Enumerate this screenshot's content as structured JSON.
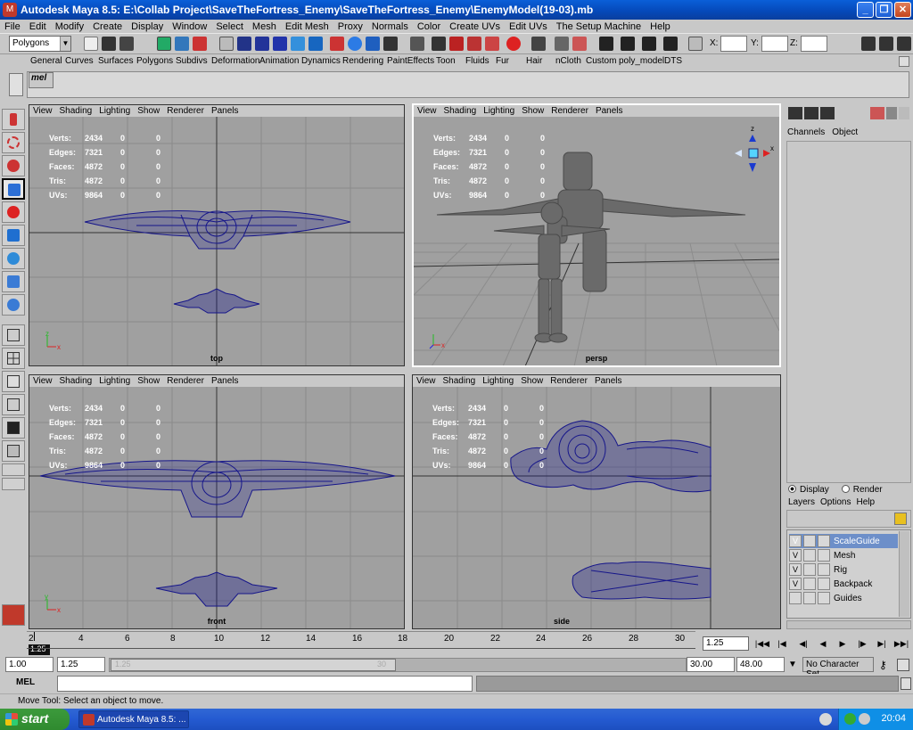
{
  "window": {
    "title": "Autodesk Maya 8.5: E:\\Collab Project\\SaveTheFortress_Enemy\\SaveTheFortress_Enemy\\EnemyModel(19-03).mb",
    "minimize": "_",
    "maximize": "❐",
    "close": "✕"
  },
  "menus": [
    "File",
    "Edit",
    "Modify",
    "Create",
    "Display",
    "Window",
    "Select",
    "Mesh",
    "Edit Mesh",
    "Proxy",
    "Normals",
    "Color",
    "Create UVs",
    "Edit UVs",
    "The Setup Machine",
    "Help"
  ],
  "status_line": {
    "menu_set": "Polygons",
    "x_label": "X:",
    "y_label": "Y:",
    "z_label": "Z:"
  },
  "shelf_tabs": [
    "General",
    "Curves",
    "Surfaces",
    "Polygons",
    "Subdivs",
    "Deformation",
    "Animation",
    "Dynamics",
    "Rendering",
    "PaintEffects",
    "Toon",
    "Fluids",
    "Fur",
    "Hair",
    "nCloth",
    "Custom",
    "poly_model",
    "DTS"
  ],
  "shelf": {
    "mel_button": "mel"
  },
  "viewport_menu": [
    "View",
    "Shading",
    "Lighting",
    "Show",
    "Renderer",
    "Panels"
  ],
  "hud": {
    "rows": [
      {
        "label": "Verts:",
        "v1": "2434",
        "v2": "0",
        "v3": "0"
      },
      {
        "label": "Edges:",
        "v1": "7321",
        "v2": "0",
        "v3": "0"
      },
      {
        "label": "Faces:",
        "v1": "4872",
        "v2": "0",
        "v3": "0"
      },
      {
        "label": "Tris:",
        "v1": "4872",
        "v2": "0",
        "v3": "0"
      },
      {
        "label": "UVs:",
        "v1": "9864",
        "v2": "0",
        "v3": "0"
      }
    ]
  },
  "viewports": {
    "top": "top",
    "persp": "persp",
    "front": "front",
    "side": "side"
  },
  "axes": {
    "x": "x",
    "y": "y",
    "z": "z"
  },
  "channel_box": {
    "tabs": [
      "Channels",
      "Object"
    ]
  },
  "layer_editor": {
    "display_radio": "Display",
    "render_radio": "Render",
    "menu": [
      "Layers",
      "Options",
      "Help"
    ],
    "layers": [
      {
        "vis": "V",
        "name": "ScaleGuide",
        "selected": true
      },
      {
        "vis": "V",
        "name": "Mesh",
        "selected": false
      },
      {
        "vis": "V",
        "name": "Rig",
        "selected": false
      },
      {
        "vis": "V",
        "name": "Backpack",
        "selected": false
      },
      {
        "vis": "",
        "name": "Guides",
        "selected": false
      }
    ]
  },
  "time_slider": {
    "ticks": [
      "2",
      "4",
      "6",
      "8",
      "10",
      "12",
      "14",
      "16",
      "18",
      "20",
      "22",
      "24",
      "26",
      "28",
      "30"
    ],
    "current_marker": "1.25",
    "current_frame": "1.25"
  },
  "range_slider": {
    "start": "1.00",
    "playback_start": "1.25",
    "thumb_start": "1.25",
    "thumb_end": "30",
    "playback_end": "30.00",
    "end": "48.00",
    "character_set": "No Character Set"
  },
  "command_line": {
    "label": "MEL"
  },
  "help_line": {
    "text": "Move Tool: Select an object to move."
  },
  "taskbar": {
    "start": "start",
    "task": "Autodesk Maya 8.5: ...",
    "clock": "20:04"
  },
  "colors": {
    "wire": "#16168a",
    "viewport_bg": "#a0a0a0",
    "title_blue": "#0548b8",
    "layer_selected": "#6d8fc9"
  }
}
